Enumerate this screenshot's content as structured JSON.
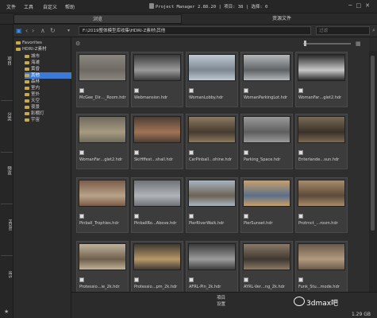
{
  "menu": [
    "文件",
    "工具",
    "自定义",
    "帮助"
  ],
  "app": {
    "title": "Project Manager 2.88.20",
    "count_label": "项目",
    "count": "38",
    "select_label": "选择",
    "select": "0"
  },
  "tabs": {
    "browse": "浏览",
    "resources": "资源文件"
  },
  "left_tabs": [
    "项目",
    "分类",
    "预览",
    "HDRI",
    "IES"
  ],
  "address": {
    "path": "F:\\2019整体模型库收集\\HDRI-Z素材\\其他",
    "search_placeholder": "过滤"
  },
  "tree": {
    "favorites": "Favorites",
    "root": "HDRI-Z素材",
    "items": [
      "城市",
      "海滩",
      "黄昏",
      "其他",
      "森林",
      "室内",
      "室外",
      "天空",
      "夜景",
      "影棚灯",
      "宇宙"
    ],
    "selected_index": 3
  },
  "files": [
    "McGee_Dir…_Room.hdr",
    "Webmansion.hdr",
    "WomanLobby.hdr",
    "WomanParkingLot.hdr",
    "WomanFar…glet2.hdr",
    "WomanFar…glet2.hdr",
    "SkiHffest…shall.hdr",
    "CarPinball…ohine.hdr",
    "Parking_Space.hdr",
    "Enterlande…sun.hdr",
    "Pinball_Trophies.hdr",
    "PinballRo…Above.hdr",
    "PierRiverWalk.hdr",
    "PierSunset.hdr",
    "Protrnct_…rosm.hdr",
    "Protessio…ie_2k.hdr",
    "Protessio…pm_2k.hdr",
    "AFRL-Pin_2k.hdr",
    "AYRL-Ver…ng_2k.hdr",
    "Funk_Stu…mode.hdr"
  ],
  "thumbs": [
    [
      "#8b8680",
      "#6e6a63"
    ],
    [
      "#3a3a3a",
      "#9a9a9a"
    ],
    [
      "#bfc9d2",
      "#7d8791"
    ],
    [
      "#b5b8bb",
      "#5f6366"
    ],
    [
      "#2a2a2a",
      "#c8c8c8"
    ],
    [
      "#6f6a5d",
      "#a79a80"
    ],
    [
      "#4c3e34",
      "#a07455"
    ],
    [
      "#8c7a60",
      "#463b30"
    ],
    [
      "#9a9a9a",
      "#5e5e5e"
    ],
    [
      "#7a6a55",
      "#3a3128"
    ],
    [
      "#7a5c48",
      "#b9a38a"
    ],
    [
      "#6f7378",
      "#b1b4b8"
    ],
    [
      "#a9b5c3",
      "#6b6354"
    ],
    [
      "#c8a06a",
      "#5b6f8a"
    ],
    [
      "#a78c6c",
      "#5c4a39"
    ],
    [
      "#c0b39a",
      "#6e5f4c"
    ],
    [
      "#3f3a33",
      "#b89869"
    ],
    [
      "#3c3c3c",
      "#9b9b9b"
    ],
    [
      "#8b7a66",
      "#3e3730"
    ],
    [
      "#6b5a4a",
      "#b29a80"
    ]
  ],
  "bottom": {
    "tab1": "項目",
    "tab2": "设置",
    "size": "1.29 GB"
  },
  "watermark": "3dmax吧"
}
